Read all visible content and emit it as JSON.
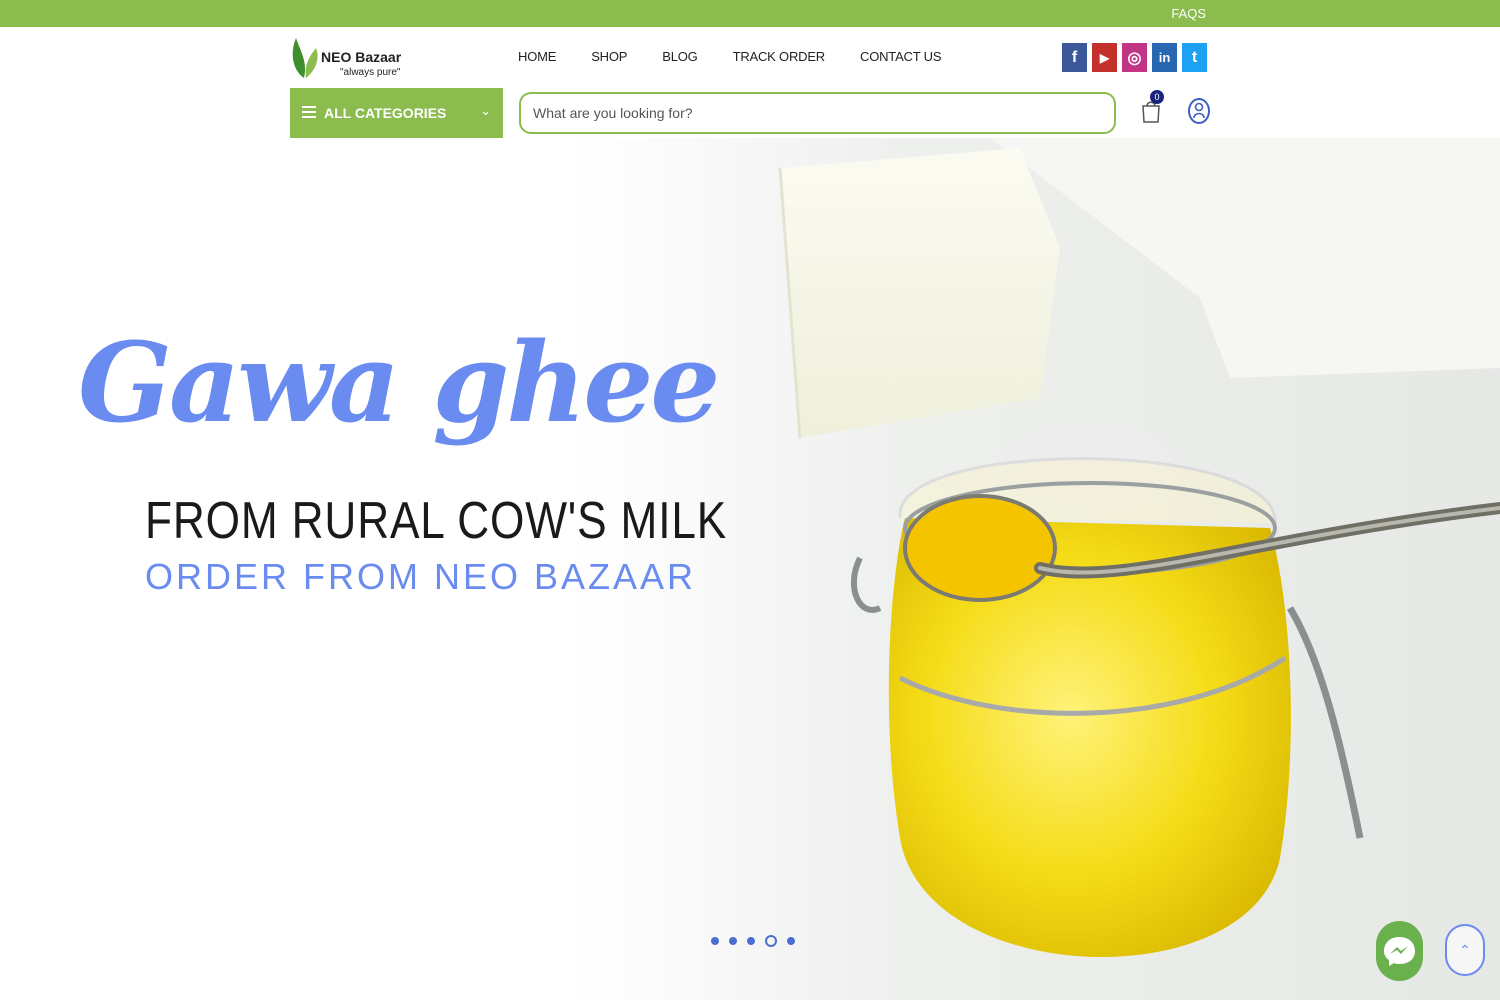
{
  "topbar": {
    "faqs_label": "FAQS"
  },
  "brand": {
    "name": "NEO Bazaar",
    "tagline": "\"always pure\""
  },
  "nav": {
    "items": [
      {
        "label": "HOME"
      },
      {
        "label": "SHOP"
      },
      {
        "label": "BLOG"
      },
      {
        "label": "TRACK ORDER"
      },
      {
        "label": "CONTACT US"
      }
    ]
  },
  "social": [
    {
      "icon": "facebook-icon",
      "color": "#3b5998",
      "glyph": "f"
    },
    {
      "icon": "youtube-icon",
      "color": "#c4302b",
      "glyph": "▶"
    },
    {
      "icon": "instagram-icon",
      "color": "#c13584",
      "glyph": "◎"
    },
    {
      "icon": "linkedin-icon",
      "color": "#2867b2",
      "glyph": "in"
    },
    {
      "icon": "twitter-icon",
      "color": "#1da1f2",
      "glyph": "t"
    }
  ],
  "categories": {
    "label": "ALL CATEGORIES"
  },
  "search": {
    "placeholder": "What are you looking for?"
  },
  "cart": {
    "count": "0"
  },
  "hero": {
    "title": "Gawa ghee",
    "subtitle": "FROM RURAL COW'S MILK",
    "cta": "ORDER FROM NEO BAZAAR",
    "slides_total": 5,
    "active_slide": 4
  },
  "colors": {
    "brand_green": "#8cbb4e",
    "accent_blue": "#6a8bef",
    "ghee_yellow": "#f2d400"
  }
}
